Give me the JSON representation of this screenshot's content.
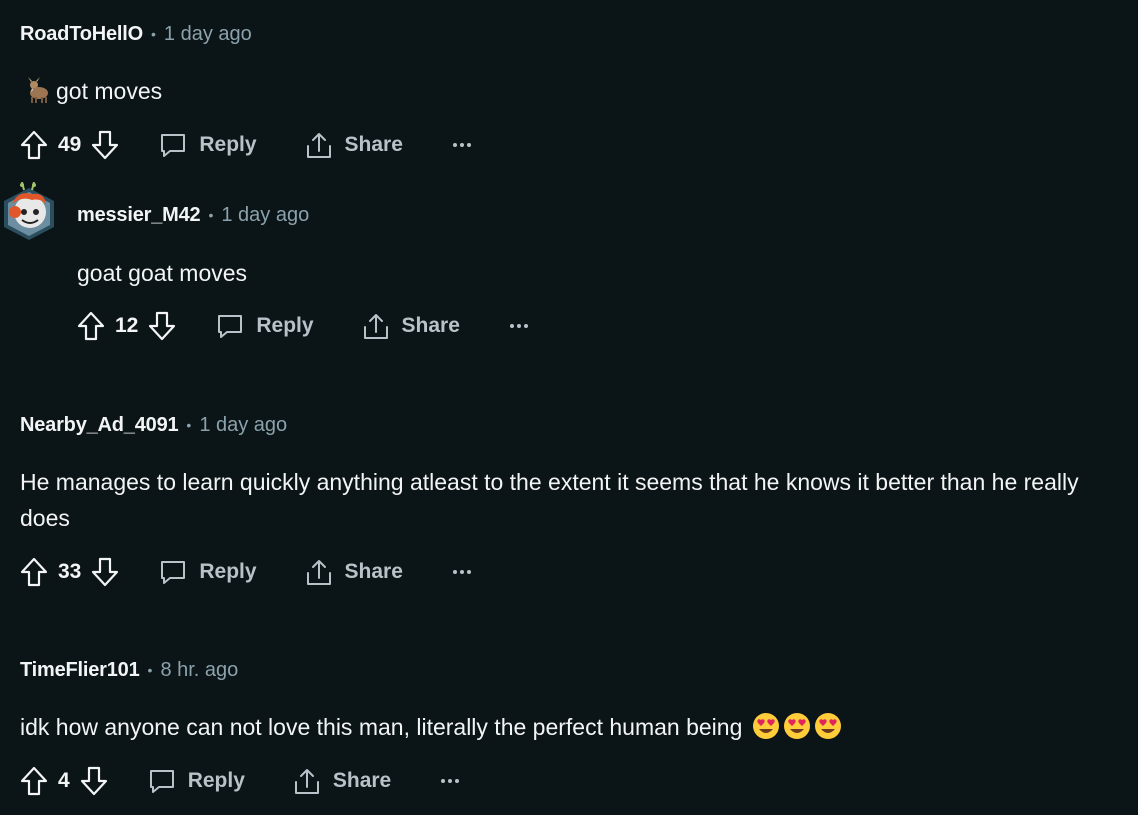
{
  "comments": [
    {
      "author": "RoadToHellO",
      "time": "1 day ago",
      "body": "got moves",
      "votes": "49",
      "reply": "Reply",
      "share": "Share",
      "prefix_emoji": "goat-emoji"
    },
    {
      "author": "messier_M42",
      "time": "1 day ago",
      "body": "goat goat moves",
      "votes": "12",
      "reply": "Reply",
      "share": "Share",
      "avatar": "snoo-avatar"
    },
    {
      "author": "Nearby_Ad_4091",
      "time": "1 day ago",
      "body": "He manages to learn quickly anything atleast to the extent it seems that he knows it better than he really does",
      "votes": "33",
      "reply": "Reply",
      "share": "Share"
    },
    {
      "author": "TimeFlier101",
      "time": "8 hr. ago",
      "body": "idk how anyone can not love this man, literally the perfect human being",
      "votes": "4",
      "reply": "Reply",
      "share": "Share",
      "suffix_emoji": "heart-eyes-emoji x3"
    }
  ],
  "colors": {
    "background": "#0b1416",
    "text": "#f2f4f5",
    "muted": "#8ba2ad",
    "action": "#b7c3c9"
  }
}
